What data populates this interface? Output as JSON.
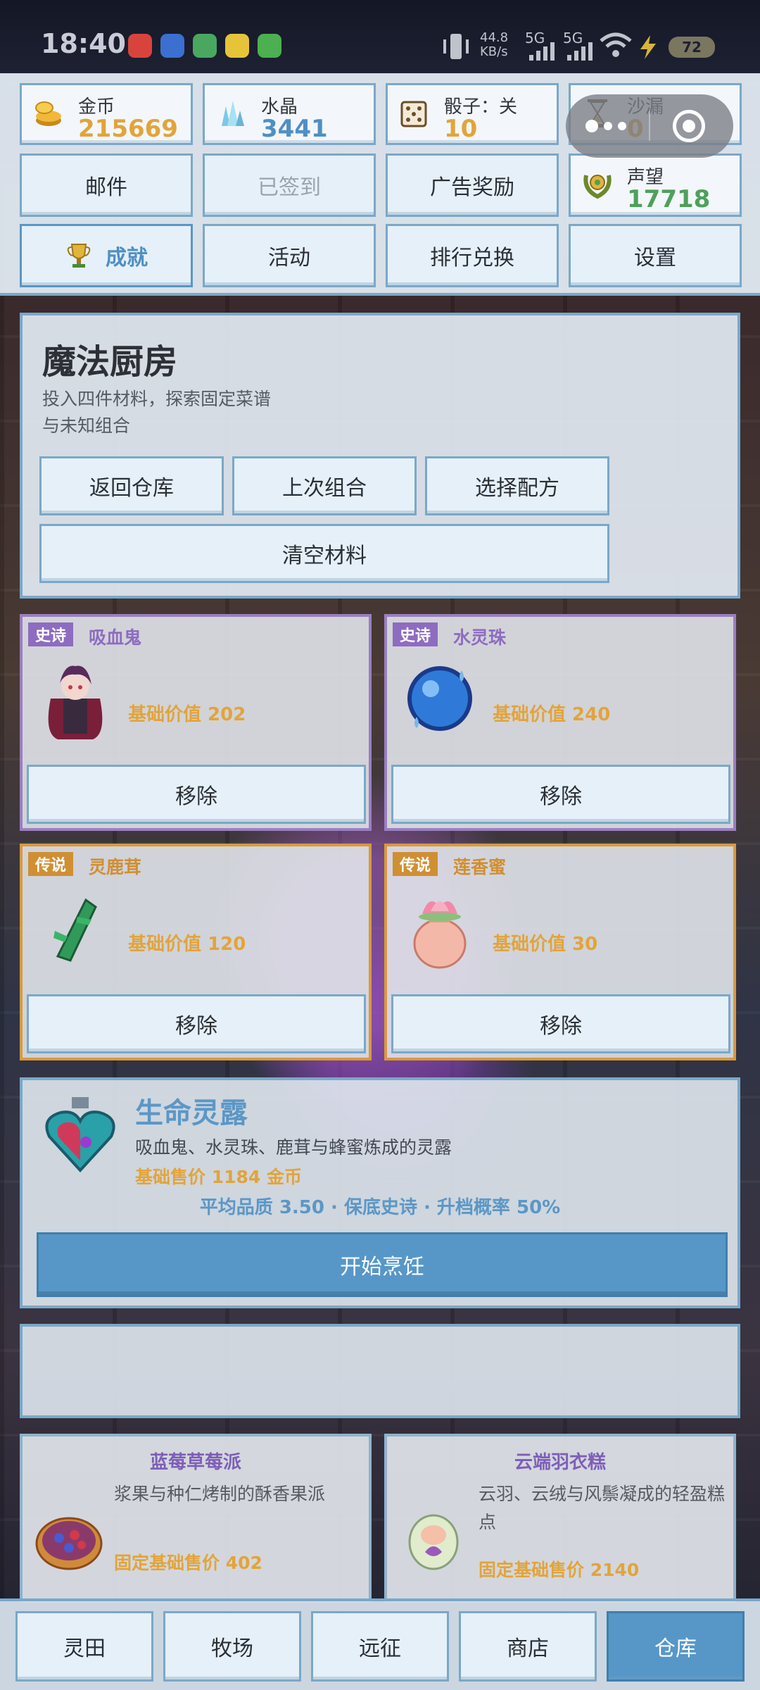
{
  "status_bar": {
    "time": "18:40",
    "net_speed": "44.8 KB/s",
    "network_1": "5G",
    "network_2": "5G",
    "battery": "72"
  },
  "resources": {
    "gold": {
      "label": "金币",
      "value": "215669"
    },
    "crystal": {
      "label": "水晶",
      "value": "3441"
    },
    "dice": {
      "label": "骰子：关",
      "value": "10"
    },
    "hourglass": {
      "label": "沙漏",
      "value": "0"
    },
    "reputation": {
      "label": "声望",
      "value": "17718"
    }
  },
  "menu": {
    "mail": "邮件",
    "signed": "已签到",
    "ad_reward": "广告奖励",
    "achievement": "成就",
    "activity": "活动",
    "rank_exchange": "排行兑换",
    "settings": "设置"
  },
  "kitchen": {
    "title": "魔法厨房",
    "description": "投入四件材料，探索固定菜谱与未知组合",
    "back": "返回仓库",
    "last_combo": "上次组合",
    "choose_recipe": "选择配方",
    "clear": "清空材料"
  },
  "ingredients": [
    {
      "rarity": "史诗",
      "name": "吸血鬼",
      "value": "基础价值 202",
      "remove": "移除"
    },
    {
      "rarity": "史诗",
      "name": "水灵珠",
      "value": "基础价值 240",
      "remove": "移除"
    },
    {
      "rarity": "传说",
      "name": "灵鹿茸",
      "value": "基础价值 120",
      "remove": "移除"
    },
    {
      "rarity": "传说",
      "name": "莲香蜜",
      "value": "基础价值 30",
      "remove": "移除"
    }
  ],
  "result": {
    "name": "生命灵露",
    "description": "吸血鬼、水灵珠、鹿茸与蜂蜜炼成的灵露",
    "price": "基础售价 1184 金币",
    "stats": "平均品质 3.50 · 保底史诗 · 升档概率 50%",
    "cook": "开始烹饪"
  },
  "recipes": [
    {
      "name": "蓝莓草莓派",
      "description": "浆果与种仁烤制的酥香果派",
      "price": "固定基础售价 402"
    },
    {
      "name": "云端羽衣糕",
      "description": "云羽、云绒与风鬃凝成的轻盈糕点",
      "price": "固定基础售价 2140"
    }
  ],
  "nav": {
    "field": "灵田",
    "ranch": "牧场",
    "expedition": "远征",
    "shop": "商店",
    "warehouse": "仓库"
  },
  "colors": {
    "accent": "#5797c8",
    "gold": "#e2a43a",
    "epic": "#8e6cc1",
    "legend": "#d08f32",
    "reputation": "#4ea05a"
  }
}
